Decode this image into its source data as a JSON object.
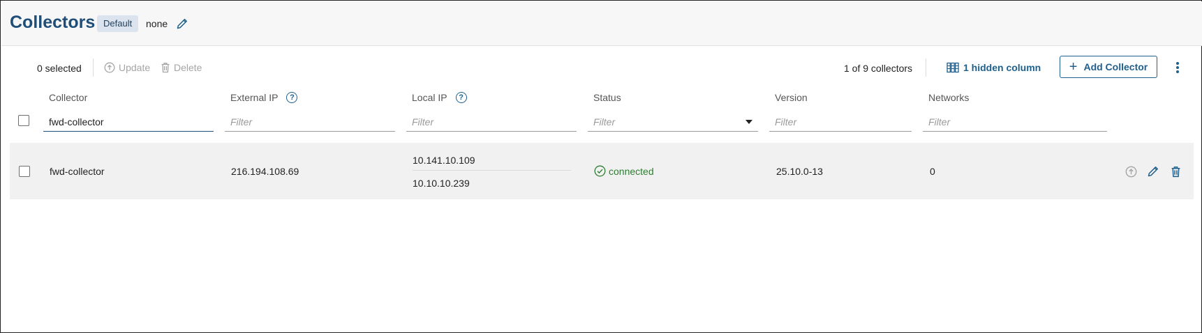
{
  "header": {
    "title": "Collectors",
    "badge": "Default",
    "tag_value": "none"
  },
  "toolbar": {
    "selected_count": "0 selected",
    "update_label": "Update",
    "delete_label": "Delete",
    "counter": "1 of 9 collectors",
    "hidden_columns_label": "1 hidden column",
    "add_label": "Add Collector"
  },
  "columns": {
    "collector": "Collector",
    "external_ip": "External IP",
    "local_ip": "Local IP",
    "status": "Status",
    "version": "Version",
    "networks": "Networks"
  },
  "filters": {
    "collector_value": "fwd-collector",
    "placeholder": "Filter",
    "status_placeholder": "Filter"
  },
  "rows": [
    {
      "collector": "fwd-collector",
      "external_ip": "216.194.108.69",
      "local_ips": [
        "10.141.10.109",
        "10.10.10.239"
      ],
      "status": "connected",
      "version": "25.10.0-13",
      "networks": "0"
    }
  ],
  "colors": {
    "accent": "#1f5f8b",
    "title": "#1f4e79",
    "status_ok": "#2e7d32",
    "disabled": "#a5a5a5"
  },
  "icons": {
    "header_edit": "pencil-icon",
    "update": "upload-icon",
    "delete": "trash-icon",
    "hidden_columns": "columns-icon",
    "add": "plus-icon",
    "more": "kebab-icon",
    "help": "help-circle-icon",
    "status": "check-circle-icon"
  }
}
